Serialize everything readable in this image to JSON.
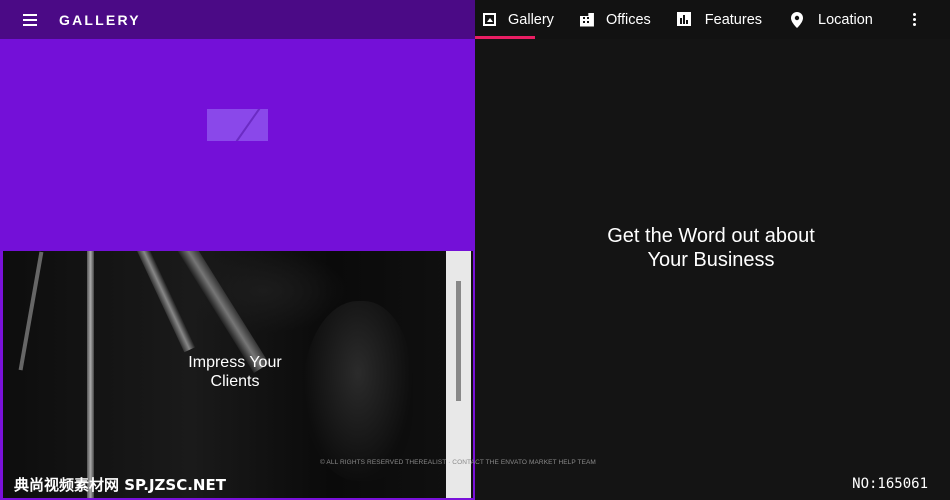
{
  "appbar": {
    "title": "GALLERY",
    "menu_icon": "menu-icon"
  },
  "tabs": [
    {
      "label": "Gallery",
      "icon": "image-icon",
      "active": true
    },
    {
      "label": "Offices",
      "icon": "office-building-icon",
      "active": false
    },
    {
      "label": "Features",
      "icon": "bar-chart-icon",
      "active": false
    },
    {
      "label": "Location",
      "icon": "location-pin-icon",
      "active": false
    }
  ],
  "more_icon": "more-vertical-icon",
  "gallery": {
    "photo_caption": "Impress Your\nClients"
  },
  "main": {
    "headline": "Get the Word out about\nYour Business"
  },
  "footer": {
    "note": "© ALL RIGHTS RESERVED THEREALIST · CONTACT THE ENVATO MARKET HELP TEAM"
  },
  "watermarks": {
    "left": "典尚视频素材网 SP.JZSC.NET",
    "right": "NO:165061"
  },
  "colors": {
    "left_purple": "#7410d8",
    "appbar": "#4b0a86",
    "tab_indicator": "#e91e63",
    "right_bg": "#141414"
  }
}
